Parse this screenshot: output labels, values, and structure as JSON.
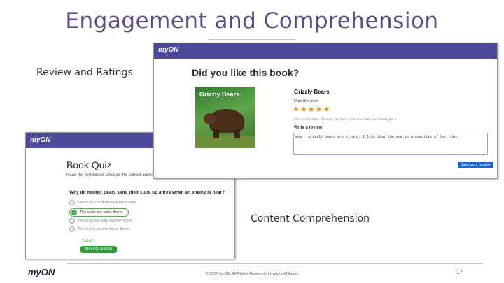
{
  "slide": {
    "title": "Engagement and Comprehension",
    "callout_review": "Review and Ratings",
    "callout_quiz": "Content Comprehension",
    "footer_logo": "myON",
    "footer": "© 2017 myON. All Rights Reserved.  |  www.myON.com",
    "page_number": "17"
  },
  "quiz_window": {
    "logo": "myON",
    "title": "Book Quiz",
    "instructions": "Read the text below. Choose the correct answer.",
    "question": "Why do mother bears send their cubs up a tree when an enemy is near?",
    "options": [
      "The cubs can find more food there.",
      "The cubs are safer there.",
      "The cubs will stay warmer there.",
      "The cubs can see better there."
    ],
    "selected_index": 1,
    "submit_text": "Super!",
    "next_button": "Next Question"
  },
  "review_window": {
    "logo": "myON",
    "heading": "Did you like this book?",
    "cover_title": "Grizzly Bears",
    "book_title": "Grizzly Bears",
    "rate_label": "Rate this book",
    "rating": 5,
    "max_rating": 5,
    "hint": "Click on the stars. The more you liked it, the more stars you should give it.",
    "write_label": "Write a review",
    "review_text": "Wow - grizzly bears are strong. I like that the mom is protective of her cubs.",
    "save_button": "Save your review"
  },
  "colors": {
    "title": "#5b4a8a",
    "app_bar": "#4d4a9a",
    "star": "#e39b1e",
    "quiz_accent": "#2e9e3a",
    "save_button": "#1d66c9"
  },
  "icons": [
    "star-icon",
    "radio-icon",
    "myon-logo"
  ]
}
